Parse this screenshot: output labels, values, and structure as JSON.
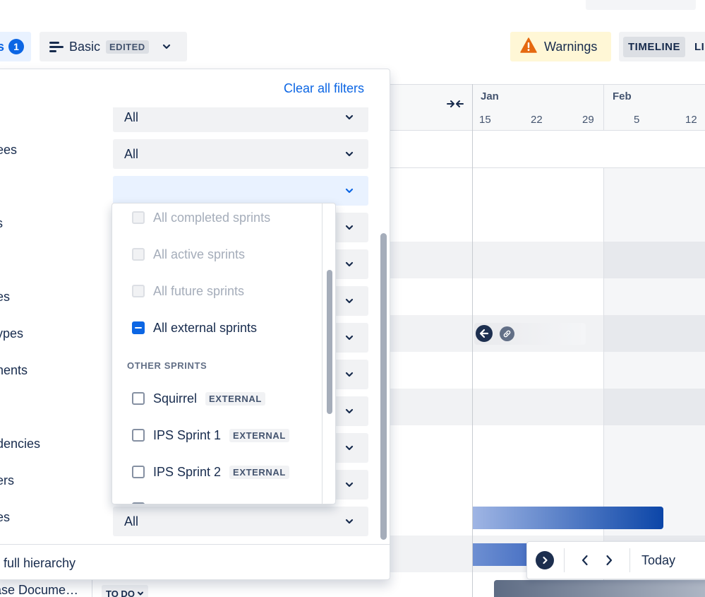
{
  "colors": {
    "accent": "#0c66e4",
    "warning_bg": "#fff7d6",
    "warning_icon": "#e56910",
    "nav_dark": "#1d2f4f"
  },
  "toolbar": {
    "filters_label": "s",
    "filters_count": "1",
    "view_name": "Basic",
    "view_badge": "EDITED",
    "warnings_label": "Warnings",
    "tabs": [
      {
        "label": "TIMELINE",
        "active": true
      },
      {
        "label": "LIS",
        "active": false
      }
    ]
  },
  "timeline": {
    "months": [
      "Jan",
      "Feb"
    ],
    "days": [
      "15",
      "22",
      "29",
      "5",
      "12"
    ]
  },
  "navigator": {
    "today_label": "Today"
  },
  "filter_panel": {
    "clear_all_label": "Clear all filters",
    "rows": [
      {
        "label": "",
        "value": "All"
      },
      {
        "label": "ees",
        "value": "All"
      },
      {
        "label": "",
        "value": ""
      },
      {
        "label": "s",
        "value": ""
      },
      {
        "label": "",
        "value": ""
      },
      {
        "label": "es",
        "value": ""
      },
      {
        "label": "ypes",
        "value": ""
      },
      {
        "label": "nents",
        "value": ""
      },
      {
        "label": "",
        "value": ""
      },
      {
        "label": "dencies",
        "value": ""
      },
      {
        "label": "ers",
        "value": ""
      },
      {
        "label": "es",
        "value": "All"
      }
    ],
    "footer_label": "full hierarchy"
  },
  "sprint_dropdown": {
    "items": [
      {
        "label": "All completed sprints",
        "state": "disabled",
        "badge": ""
      },
      {
        "label": "All active sprints",
        "state": "disabled",
        "badge": ""
      },
      {
        "label": "All future sprints",
        "state": "disabled",
        "badge": ""
      },
      {
        "label": "All external sprints",
        "state": "indeterminate",
        "badge": ""
      }
    ],
    "group_label": "OTHER SPRINTS",
    "other": [
      {
        "label": "Squirrel",
        "badge": "EXTERNAL"
      },
      {
        "label": "IPS Sprint 1",
        "badge": "EXTERNAL"
      },
      {
        "label": "IPS Sprint 2",
        "badge": "EXTERNAL"
      }
    ]
  },
  "bottom_row": {
    "title": "ase Docume…",
    "status": "TO DO"
  }
}
